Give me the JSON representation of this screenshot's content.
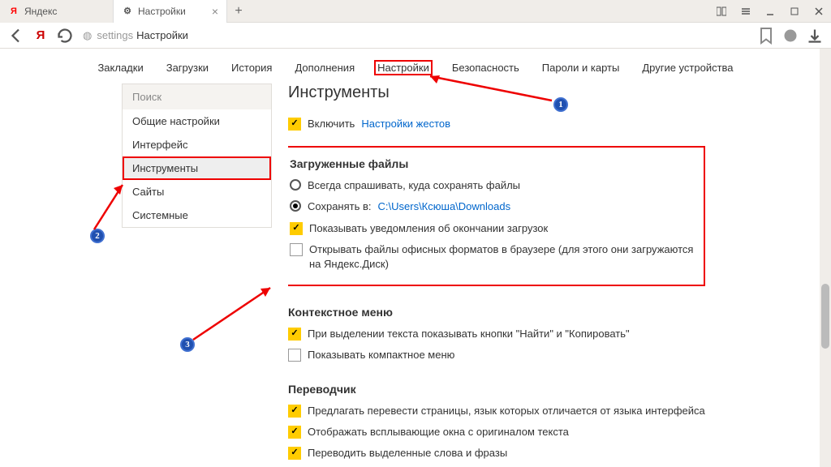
{
  "tabs": [
    {
      "favicon": "Я",
      "favicon_color": "#ff0000",
      "title": "Яндекс",
      "active": false
    },
    {
      "favicon": "⚙",
      "favicon_color": "#666",
      "title": "Настройки",
      "active": true
    }
  ],
  "address": {
    "prefix": "settings",
    "page": "Настройки"
  },
  "topnav": [
    "Закладки",
    "Загрузки",
    "История",
    "Дополнения",
    "Настройки",
    "Безопасность",
    "Пароли и карты",
    "Другие устройства"
  ],
  "topnav_highlighted": 4,
  "sidebar": {
    "search_placeholder": "Поиск",
    "items": [
      "Общие настройки",
      "Интерфейс",
      "Инструменты",
      "Сайты",
      "Системные"
    ],
    "highlighted": 2
  },
  "panel": {
    "title": "Инструменты",
    "enable_row": {
      "label": "Включить",
      "link": "Настройки жестов"
    },
    "downloads": {
      "title": "Загруженные файлы",
      "radio_ask": "Всегда спрашивать, куда сохранять файлы",
      "radio_save_prefix": "Сохранять в:",
      "radio_save_path": "C:\\Users\\Ксюша\\Downloads",
      "chk_notify": "Показывать уведомления об окончании загрузок",
      "chk_office": "Открывать файлы офисных форматов в браузере (для этого они загружаются на Яндекс.Диск)"
    },
    "context_menu": {
      "title": "Контекстное меню",
      "chk_findcopy": "При выделении текста показывать кнопки \"Найти\" и \"Копировать\"",
      "chk_compact": "Показывать компактное меню"
    },
    "translator": {
      "title": "Переводчик",
      "chk_offer": "Предлагать перевести страницы, язык которых отличается от языка интерфейса",
      "chk_popup": "Отображать всплывающие окна с оригиналом текста",
      "chk_selected": "Переводить выделенные слова и фразы"
    }
  },
  "markers": {
    "m1": "1",
    "m2": "2",
    "m3": "3"
  }
}
